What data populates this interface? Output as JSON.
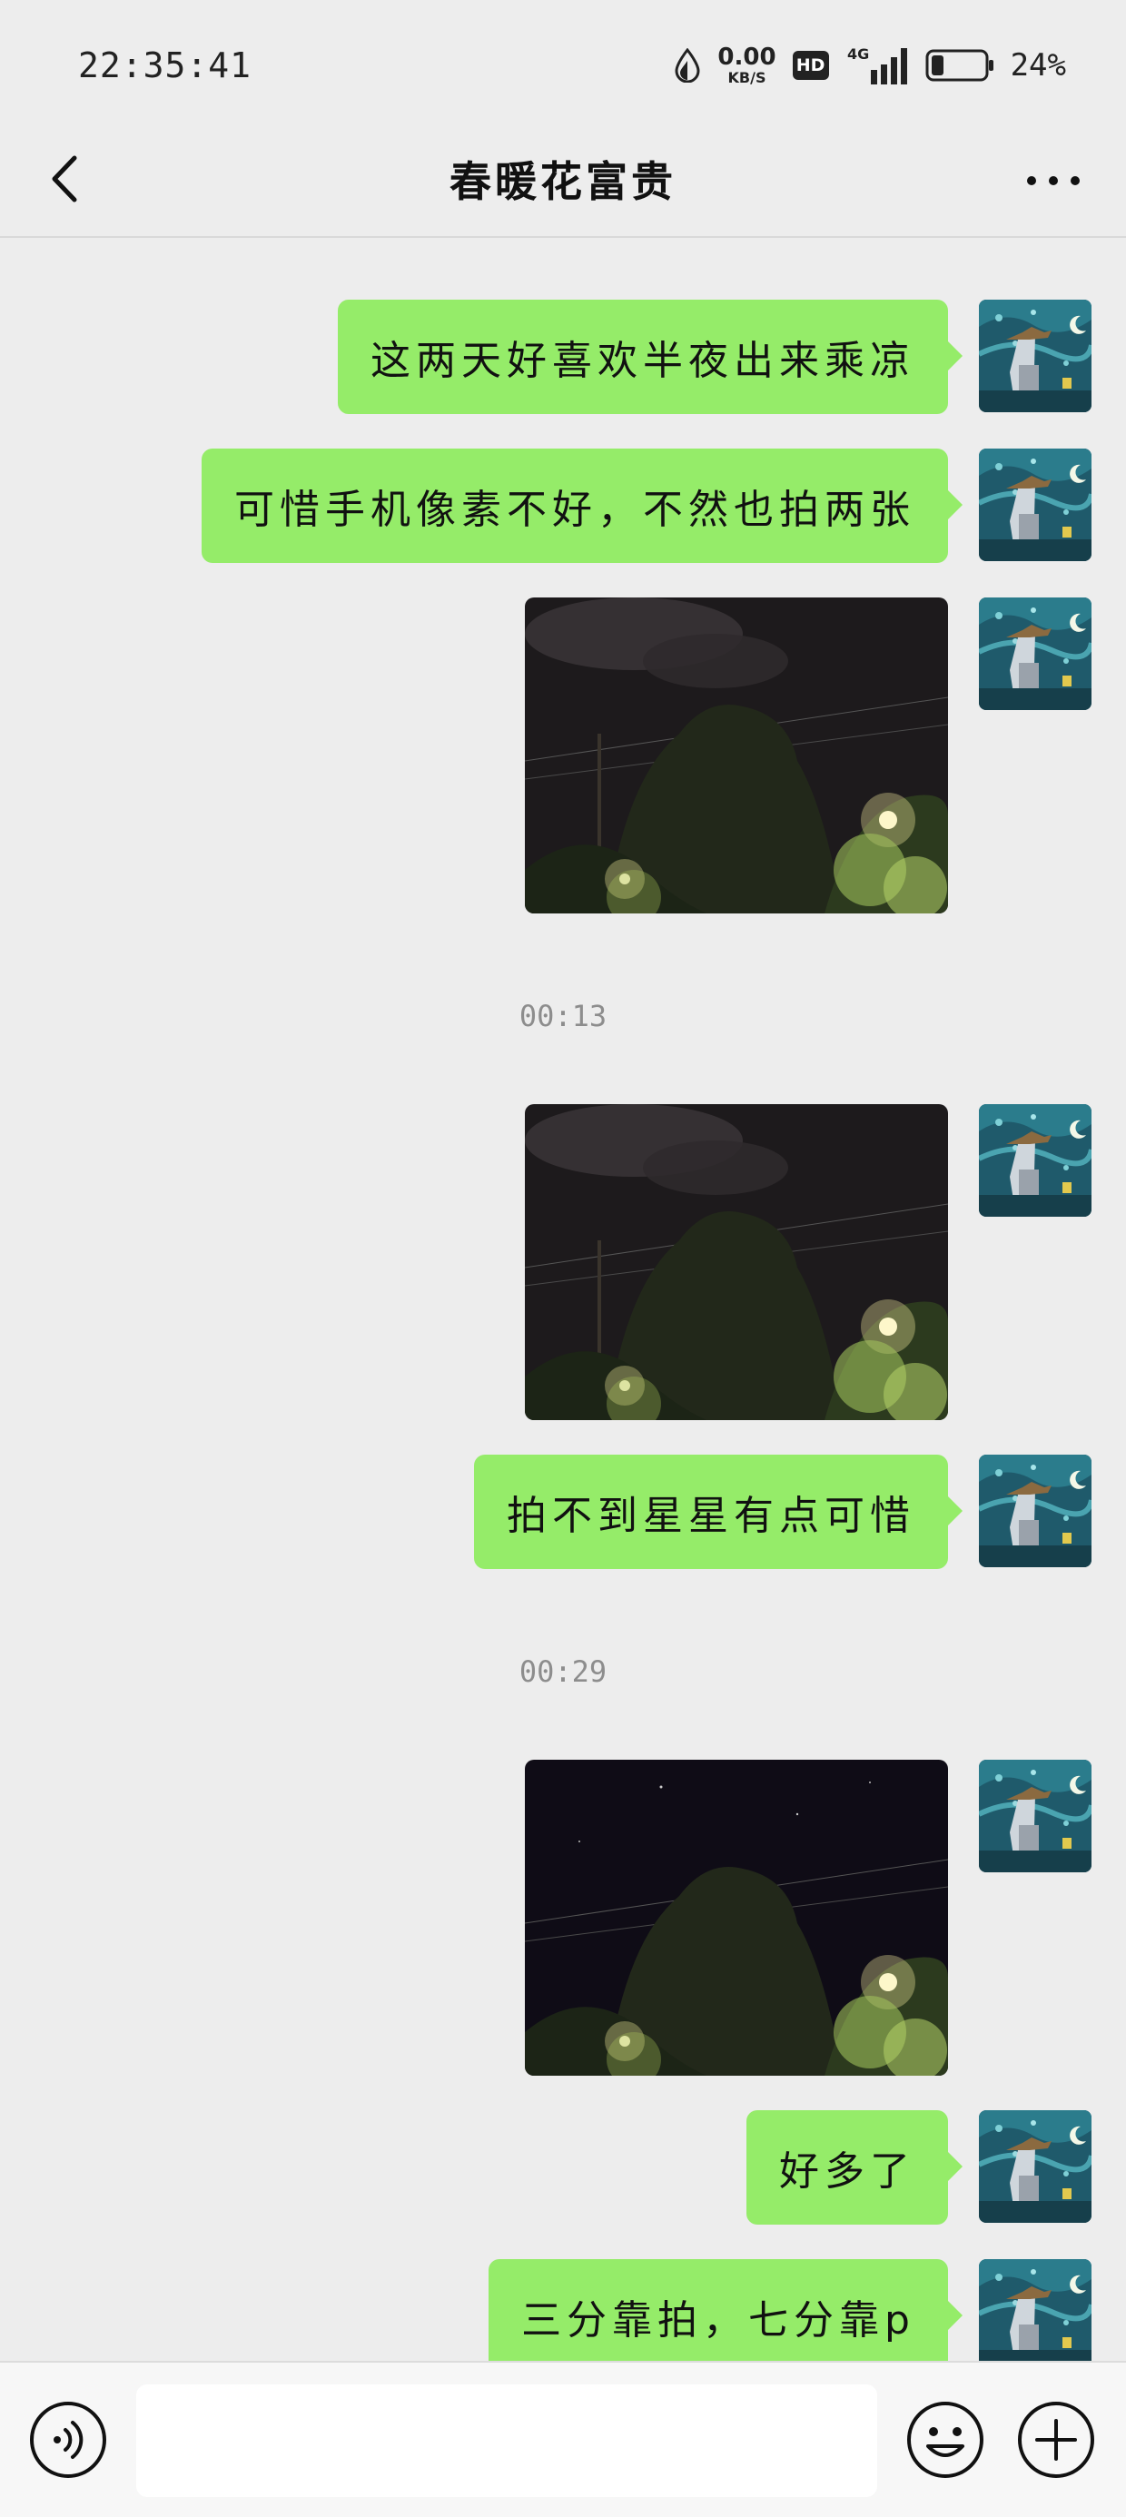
{
  "status_bar": {
    "time": "22:35:41",
    "net_speed_value": "0.00",
    "net_speed_unit": "KB/S",
    "hd_label": "HD",
    "network_label": "4G",
    "battery_percent": "24%",
    "battery_level": 0.24
  },
  "header": {
    "title": "春暖花富贵",
    "back_icon": "chevron-left-icon",
    "more_icon": "ellipsis-icon"
  },
  "messages": [
    {
      "type": "text",
      "from": "me",
      "text": "这两天好喜欢半夜出来乘凉"
    },
    {
      "type": "text",
      "from": "me",
      "text": "可惜手机像素不好，不然也拍两张"
    },
    {
      "type": "image",
      "from": "me",
      "description": "night-trees-photo"
    },
    {
      "type": "time",
      "text": "00:13"
    },
    {
      "type": "image",
      "from": "me",
      "description": "night-trees-photo"
    },
    {
      "type": "text",
      "from": "me",
      "text": "拍不到星星有点可惜"
    },
    {
      "type": "time",
      "text": "00:29"
    },
    {
      "type": "image",
      "from": "me",
      "description": "night-trees-photo"
    },
    {
      "type": "text",
      "from": "me",
      "text": "好多了"
    },
    {
      "type": "text",
      "from": "me",
      "text": "三分靠拍，七分靠p"
    }
  ],
  "input_bar": {
    "voice_icon": "voice-icon",
    "input_value": "",
    "emoji_icon": "emoji-icon",
    "plus_icon": "plus-icon"
  },
  "colors": {
    "background": "#ededed",
    "bubble_green": "#95ec69",
    "timestamp_gray": "#8d8d8d"
  }
}
